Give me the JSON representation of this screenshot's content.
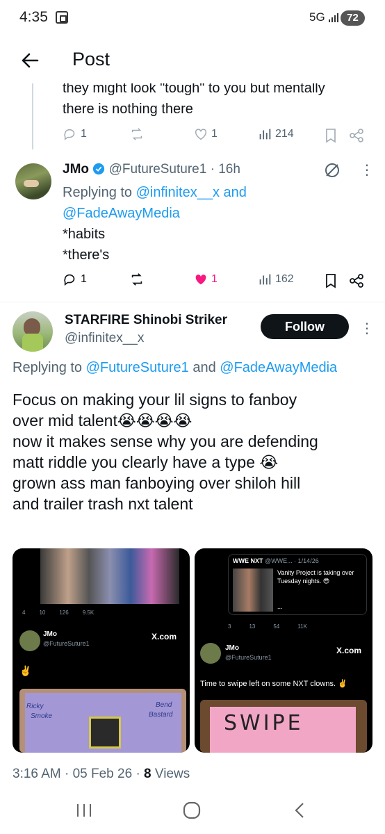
{
  "status_bar": {
    "time": "4:35",
    "network": "5G",
    "battery": "72"
  },
  "header": {
    "title": "Post"
  },
  "previous_reply": {
    "text_line1": "they might look \"tough\" to you but mentally",
    "text_line2": "there is nothing there",
    "reply_count": "1",
    "repost_count": "",
    "like_count": "1",
    "view_count": "214"
  },
  "reply_jmo": {
    "name": "JMo",
    "handle": "@FutureSuture1",
    "time": "16h",
    "replying_prefix": "Replying to ",
    "replying_users_line1": "@infinitex__x and",
    "replying_users_line2": "@FadeAwayMedia",
    "text_line1": "*habits",
    "text_line2": "*there's",
    "reply_count": "1",
    "like_count": "1",
    "view_count": "162",
    "like_color": "#f91880"
  },
  "main_tweet": {
    "name": "STARFIRE Shinobi Striker",
    "handle": "@infinitex__x",
    "follow_label": "Follow",
    "replying_prefix": "Replying to ",
    "replying_user1": "@FutureSuture1",
    "replying_and": " and ",
    "replying_user2": "@FadeAwayMedia",
    "lines": [
      "Focus on making your lil signs to fanboy",
      "over mid talent😭😭😭😭",
      "now it makes sense why you are defending",
      "matt riddle you clearly have a type 😭",
      "grown ass man fanboying over shiloh hill",
      "and trailer trash nxt talent"
    ],
    "timestamp": "3:16 AM · 05 Feb 26 · ",
    "views_count": "8",
    "views_label": " Views"
  },
  "media_left": {
    "stats": [
      "4",
      "10",
      "126",
      "9.5K"
    ],
    "name": "JMo",
    "handle": "@FutureSuture1",
    "brand": "X.com",
    "emoji": "✌️",
    "sign_text1": "Ricky",
    "sign_text2": "Smoke",
    "sign_text3": "Bend",
    "sign_text4": "Bastard"
  },
  "media_right": {
    "quoted_name": "WWE NXT",
    "quoted_handle": "@WWE...",
    "quoted_date": "1/14/26",
    "quoted_text": "Vanity Project is taking over Tuesday nights. 😎",
    "quoted_more": "...",
    "stats": [
      "3",
      "13",
      "54",
      "11K"
    ],
    "name": "JMo",
    "handle": "@FutureSuture1",
    "brand": "X.com",
    "text": "Time to swipe left on some NXT clowns. ✌️",
    "sign_text": "SWIPE"
  },
  "colors": {
    "accent": "#1d9bf0",
    "text": "#0f1419",
    "muted": "#536471",
    "like": "#f91880"
  }
}
